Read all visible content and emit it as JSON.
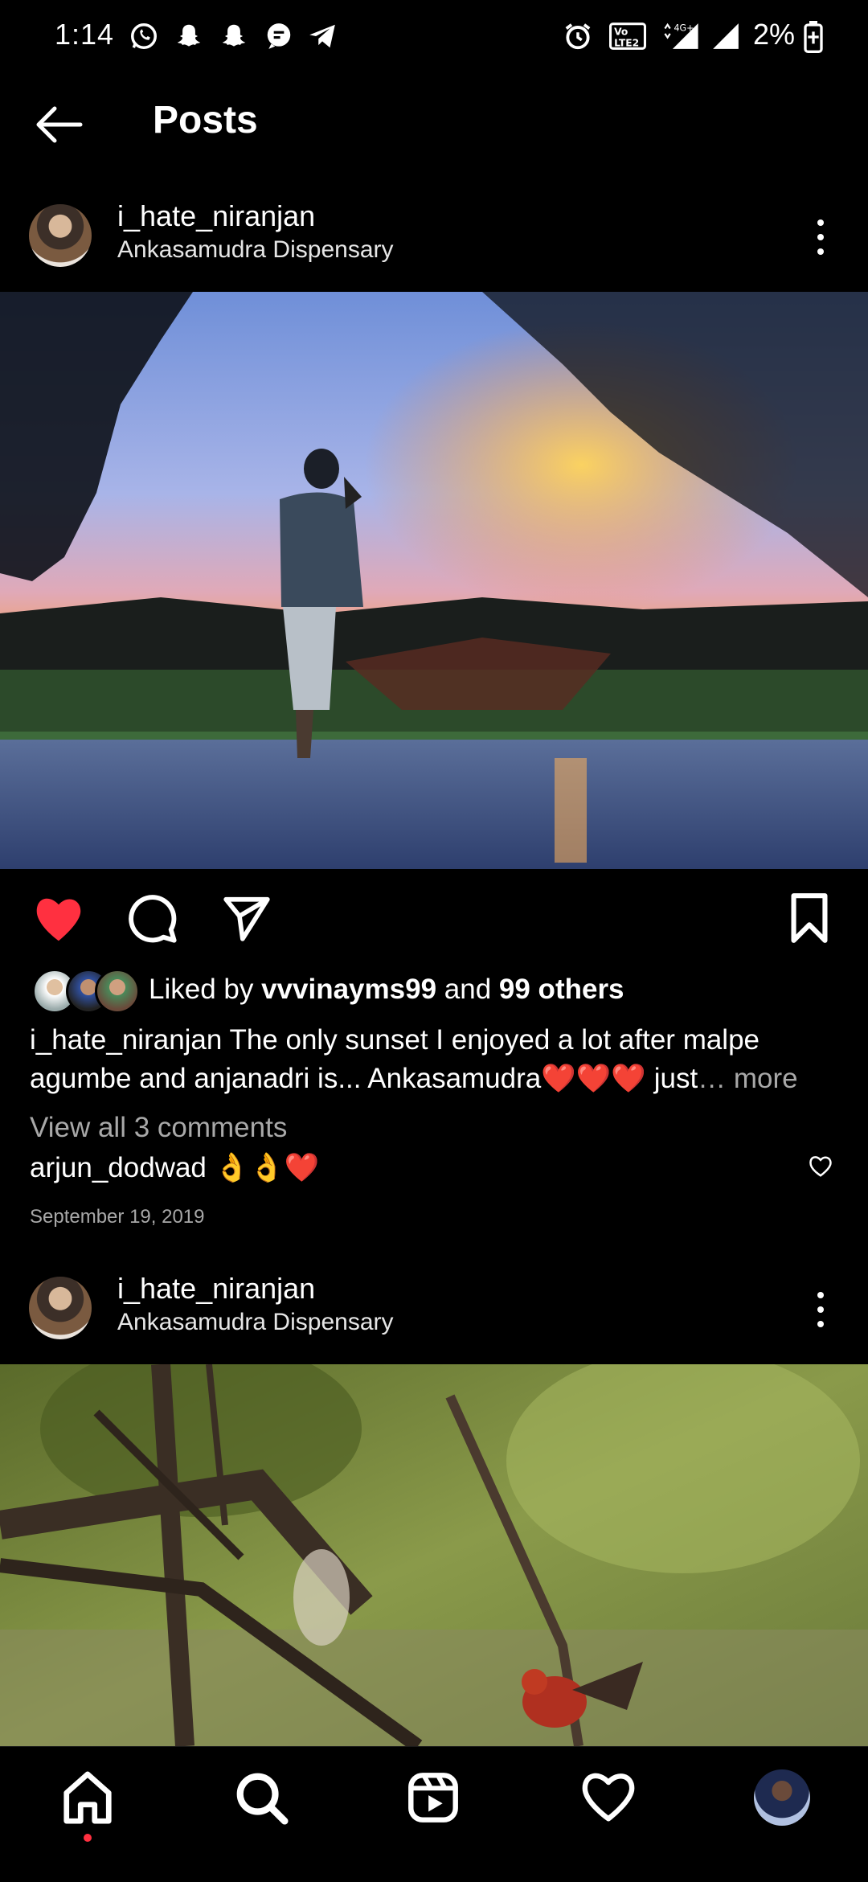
{
  "status_bar": {
    "time": "1:14",
    "battery_percent": "2%",
    "network": "4G+",
    "icons": [
      "whatsapp-icon",
      "snapchat-icon",
      "snapchat-icon",
      "messages-icon",
      "telegram-icon",
      "alarm-icon",
      "volte-icon",
      "signal-icon",
      "signal-icon",
      "battery-charging-icon"
    ]
  },
  "header": {
    "title": "Posts",
    "back_icon": "back-arrow-icon"
  },
  "posts": [
    {
      "username": "i_hate_niranjan",
      "location": "Ankasamudra Dispensary",
      "liked": true,
      "likes": {
        "prefix": "Liked by ",
        "user": "vvvinayms99",
        "middle": " and ",
        "others": "99 others"
      },
      "caption": {
        "username": "i_hate_niranjan",
        "text": " The only sunset I enjoyed a lot after malpe agumbe and anjanadri is... Ankasamudra❤️❤️❤️ just",
        "more": "… more"
      },
      "view_comments": "View all 3 comments",
      "comment": {
        "username": "arjun_dodwad",
        "text": " 👌👌❤️"
      },
      "date": "September 19, 2019"
    },
    {
      "username": "i_hate_niranjan",
      "location": "Ankasamudra Dispensary"
    }
  ],
  "colors": {
    "background": "#000000",
    "like_red": "#ff3040",
    "secondary_text": "#a8a8a8",
    "notification_dot": "#ff3040"
  },
  "bottom_nav": [
    "home-icon",
    "search-icon",
    "reels-icon",
    "activity-heart-icon",
    "profile-avatar"
  ]
}
